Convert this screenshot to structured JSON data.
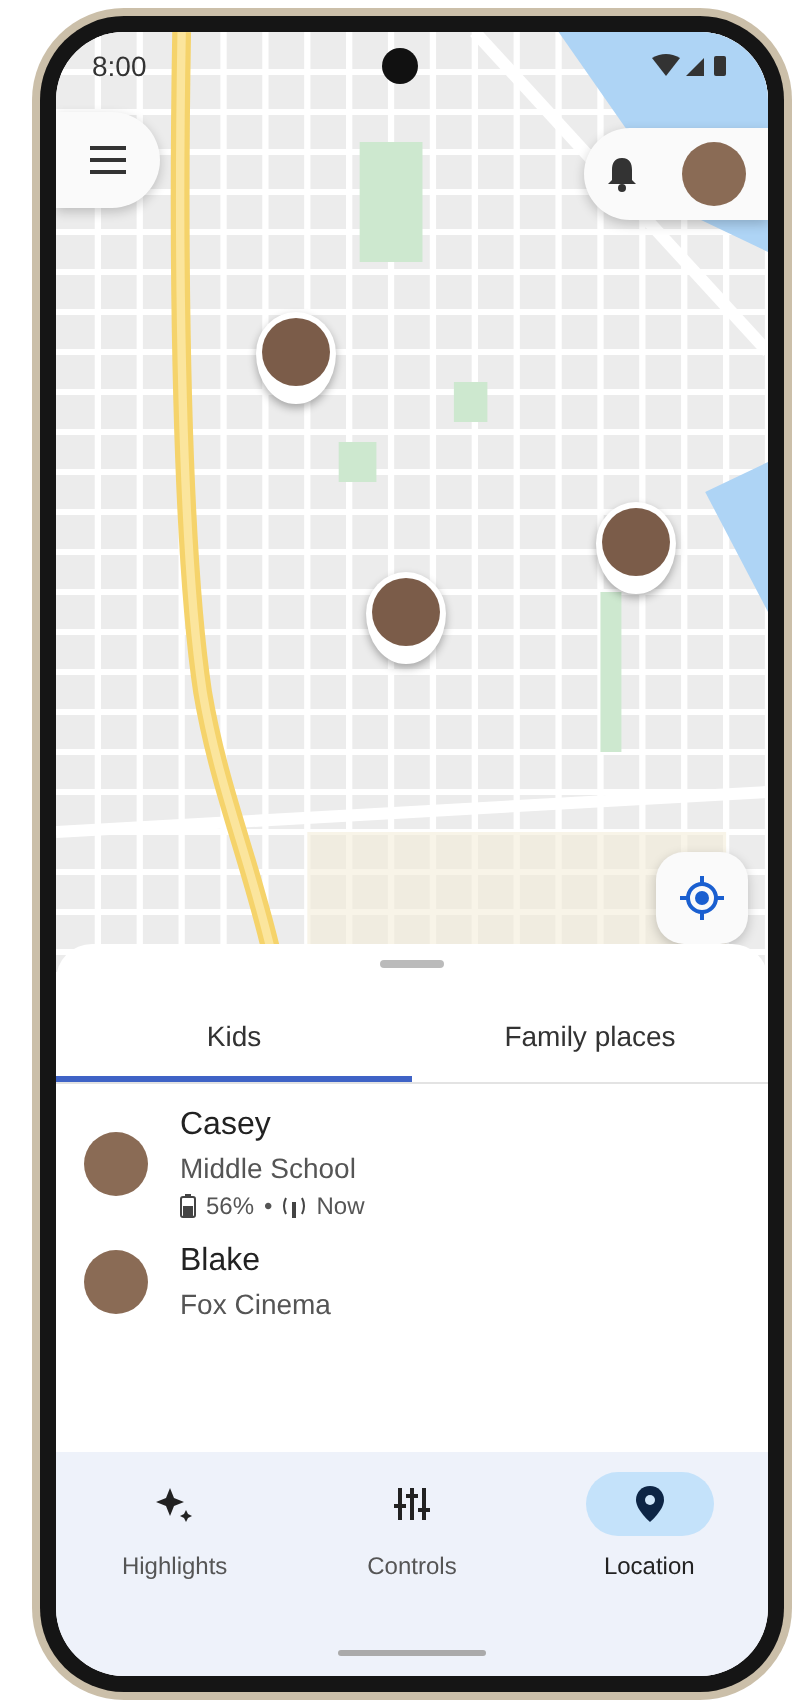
{
  "status_bar": {
    "time": "8:00"
  },
  "sheet": {
    "tabs": [
      {
        "label": "Kids",
        "selected": true
      },
      {
        "label": "Family places",
        "selected": false
      }
    ],
    "kids": [
      {
        "name": "Casey",
        "place": "Middle School",
        "battery": "56%",
        "separator": "•",
        "updated": "Now"
      },
      {
        "name": "Blake",
        "place": "Fox Cinema"
      }
    ]
  },
  "nav": [
    {
      "label": "Highlights",
      "kind": "sparkle",
      "selected": false
    },
    {
      "label": "Controls",
      "kind": "sliders",
      "selected": false
    },
    {
      "label": "Location",
      "kind": "pin",
      "selected": true
    }
  ]
}
